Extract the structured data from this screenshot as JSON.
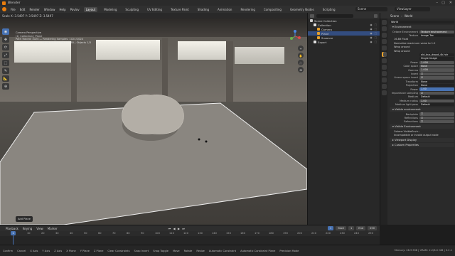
{
  "window": {
    "title": "Blender",
    "controls": [
      "–",
      "▢",
      "✕"
    ]
  },
  "menubar": {
    "menus": [
      "File",
      "Edit",
      "Render",
      "Window",
      "Help",
      "Pavlov"
    ],
    "workspaces": [
      "Layout",
      "Modeling",
      "Sculpting",
      "UV Editing",
      "Texture Paint",
      "Shading",
      "Animation",
      "Rendering",
      "Compositing",
      "Geometry Nodes",
      "Scripting"
    ],
    "active_workspace": "Layout",
    "scene": "Scene",
    "view_layer": "ViewLayer"
  },
  "viewport": {
    "header": [
      "Scale X: 3.5497  Y: 3.5497  Z: 3.5497"
    ],
    "stats": [
      "Camera Perspective",
      "(1) Collection | Plane",
      "Path Traced: 1024 — Rendering Samples: 1024/1024",
      "Plane | Verts 5.642 | Faces 5.640 | Tris 11.280 | Objects 1/3"
    ],
    "tools": [
      "◉",
      "✥",
      "⟳",
      "⤢",
      "⬚",
      "✎",
      "📐",
      "⊕"
    ],
    "nav_buttons": [
      "+",
      "✋",
      "🎥",
      "⊞"
    ],
    "last_op": "Add Plane"
  },
  "outliner": {
    "items": [
      {
        "label": "Scene Collection",
        "color": "#cccccc",
        "indent": 0,
        "selected": false
      },
      {
        "label": "Collection",
        "color": "#e0e0e0",
        "indent": 1,
        "selected": false
      },
      {
        "label": "Camera",
        "color": "#e8a12b",
        "indent": 2,
        "selected": false
      },
      {
        "label": "Plane",
        "color": "#e8a12b",
        "indent": 2,
        "selected": true
      },
      {
        "label": "Suzanne",
        "color": "#e8a12b",
        "indent": 2,
        "selected": false
      },
      {
        "label": "Export",
        "color": "#e0e0e0",
        "indent": 1,
        "selected": false
      }
    ]
  },
  "properties": {
    "header": {
      "scene_tab": "Scene",
      "world_tab": "World"
    },
    "world_name": "World",
    "rows": [
      {
        "type": "section",
        "label": "▾ Environment"
      },
      {
        "type": "field",
        "label": "Octane Environment",
        "value": "Texture environment"
      },
      {
        "type": "field",
        "label": "Texture",
        "value": "Image Tex",
        "style": "dark"
      },
      {
        "type": "plain",
        "label": "16-Bit Float"
      },
      {
        "type": "plain",
        "label": "Normalize maximum value to 1.0"
      },
      {
        "type": "plain",
        "label": "Wrap around"
      },
      {
        "type": "plain",
        "label": "Wrap around"
      },
      {
        "type": "field",
        "label": "",
        "value": "old_bus_depot_4k.hdr",
        "style": "dark"
      },
      {
        "type": "field",
        "label": "",
        "value": "Single Image",
        "style": "dark"
      },
      {
        "type": "field",
        "label": "Power",
        "value": "1.000"
      },
      {
        "type": "field",
        "label": "Color space",
        "value": "None"
      },
      {
        "type": "field",
        "label": "Gamma",
        "value": "1.000"
      },
      {
        "type": "field",
        "label": "Invert",
        "value": "☐"
      },
      {
        "type": "field",
        "label": "Linear space invert",
        "value": "☑"
      },
      {
        "type": "field",
        "label": "Transform",
        "value": "None",
        "style": "dark"
      },
      {
        "type": "field",
        "label": "Projection",
        "value": "None",
        "style": "dark"
      },
      {
        "type": "field",
        "label": "Power",
        "value": "1.00",
        "style": "blue"
      },
      {
        "type": "field",
        "label": "Importance sampling",
        "value": "☑"
      },
      {
        "type": "field",
        "label": "Medium",
        "value": "Default",
        "style": "dark"
      },
      {
        "type": "field",
        "label": "Medium radius",
        "value": "1.00"
      },
      {
        "type": "field",
        "label": "Medium light pass",
        "value": "Default",
        "style": "dark"
      },
      {
        "type": "section",
        "label": "▾ Visible environment"
      },
      {
        "type": "field",
        "label": "Backplate",
        "value": "☐"
      },
      {
        "type": "field",
        "label": "Reflections",
        "value": "☐"
      },
      {
        "type": "field",
        "label": "Refractions",
        "value": "☐"
      },
      {
        "type": "section",
        "label": "▾ Visible Environment"
      },
      {
        "type": "plain",
        "label": "Octane VisibleEnvir..."
      },
      {
        "type": "plain",
        "label": "Incompatible or invalid output node"
      },
      {
        "type": "section",
        "label": "▸ Viewport Display"
      },
      {
        "type": "section",
        "label": "▸ Custom Properties"
      }
    ]
  },
  "timeline": {
    "menus": [
      "Playback",
      "Keying",
      "View",
      "Marker"
    ],
    "current_frame": "1",
    "ticks": [
      "0",
      "10",
      "20",
      "30",
      "40",
      "50",
      "60",
      "70",
      "80",
      "90",
      "100",
      "110",
      "120",
      "130",
      "140",
      "150",
      "160",
      "170",
      "180",
      "190",
      "200",
      "210",
      "220",
      "230",
      "240",
      "250"
    ],
    "transport": "⏮ ◀ ▶ ⏭",
    "start_label": "Start",
    "start": "1",
    "end_label": "End",
    "end": "250"
  },
  "statusbar": {
    "items": [
      "Confirm",
      "Cancel",
      "X Axis",
      "Y Axis",
      "Z Axis",
      "X Plane",
      "Y Plane",
      "Z Plane",
      "Clear Constraints",
      "Snap Invert",
      "Snap Toggle",
      "Move",
      "Rotate",
      "Resize",
      "Automatic Constraint",
      "Automatic Constraint Plane",
      "Precision Mode"
    ],
    "version": "Memory: 28.9 MiB | VRAM: 2.2/8.0 GiB | 3.2.1"
  }
}
